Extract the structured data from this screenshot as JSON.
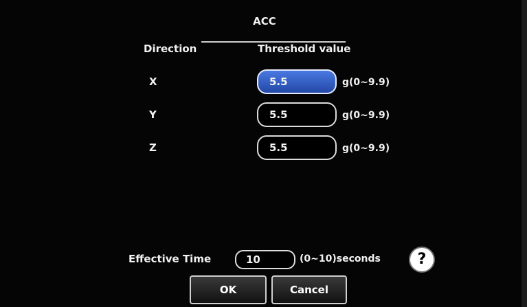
{
  "dialog": {
    "title": "ACC",
    "header_direction": "Direction",
    "header_threshold": "Threshold value"
  },
  "rows": [
    {
      "label": "X",
      "value": "5.5",
      "unit": "g(0~9.9)",
      "active": true
    },
    {
      "label": "Y",
      "value": "5.5",
      "unit": "g(0~9.9)",
      "active": false
    },
    {
      "label": "Z",
      "value": "5.5",
      "unit": "g(0~9.9)",
      "active": false
    }
  ],
  "effective_time": {
    "label": "Effective Time",
    "value": "10",
    "unit": "(0~10)seconds"
  },
  "help": {
    "glyph": "?"
  },
  "buttons": {
    "ok": "OK",
    "cancel": "Cancel"
  },
  "colors": {
    "active_field": "#3a63c8",
    "background": "#050505"
  }
}
